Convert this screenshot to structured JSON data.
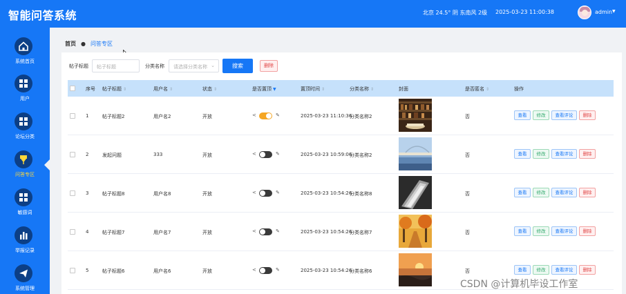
{
  "header": {
    "app_title": "智能问答系统",
    "weather": "北京  24.5°  阴  东南风  2级",
    "datetime": "2025-03-23 11:00:38",
    "username": "admin",
    "caret": "▼",
    "bg_color": "#1677f6"
  },
  "sidebar": {
    "items": [
      {
        "label": "系统首页",
        "icon": "home-icon"
      },
      {
        "label": "用户",
        "icon": "grid-icon"
      },
      {
        "label": "论坛分类",
        "icon": "grid-icon"
      },
      {
        "label": "问答专区",
        "icon": "pin-icon",
        "active": true
      },
      {
        "label": "敏感词",
        "icon": "grid-icon"
      },
      {
        "label": "举报记录",
        "icon": "bar-chart-icon"
      },
      {
        "label": "系统管理",
        "icon": "send-icon"
      }
    ]
  },
  "breadcrumb": {
    "home": "首页",
    "separator": "●",
    "current": "问答专区"
  },
  "search": {
    "title_label": "帖子标题",
    "title_placeholder": "帖子标题",
    "category_label": "分类名称",
    "category_placeholder": "请选择分类名称",
    "search_button": "搜索",
    "delete_button": "删除"
  },
  "table": {
    "columns": [
      "序号",
      "帖子标题",
      "用户名",
      "状态",
      "是否置顶",
      "置顶时间",
      "分类名称",
      "封面",
      "是否匿名",
      "操作"
    ],
    "sort_glyph": "⇕",
    "sort_active_glyph": "▼",
    "share_glyph": "<",
    "edit_glyph": "✎",
    "actions": {
      "view": "查看",
      "edit": "修改",
      "comments": "查看评论",
      "delete": "删除"
    },
    "rows": [
      {
        "index": "1",
        "title": "帖子标题2",
        "user": "用户名2",
        "status": "开放",
        "top": true,
        "time": "2025-03-23 11:10:36",
        "category": "分类名称2",
        "cover": "bookshelf",
        "anonymous": "否"
      },
      {
        "index": "2",
        "title": "发起问题",
        "user": "333",
        "status": "开放",
        "top": false,
        "time": "2025-03-23 10:59:06",
        "category": "分类名称2",
        "cover": "bridge",
        "anonymous": "否"
      },
      {
        "index": "3",
        "title": "帖子标题8",
        "user": "用户名8",
        "status": "开放",
        "top": false,
        "time": "2025-03-23 10:54:26",
        "category": "分类名称8",
        "cover": "book-pages",
        "anonymous": "否"
      },
      {
        "index": "4",
        "title": "帖子标题7",
        "user": "用户名7",
        "status": "开放",
        "top": false,
        "time": "2025-03-23 10:54:26",
        "category": "分类名称7",
        "cover": "autumn",
        "anonymous": "否"
      },
      {
        "index": "5",
        "title": "帖子标题6",
        "user": "用户名6",
        "status": "开放",
        "top": false,
        "time": "2025-03-23 10:54:26",
        "category": "分类名称6",
        "cover": "sunset",
        "anonymous": "否"
      }
    ]
  },
  "watermark": "CSDN @计算机毕设工作室"
}
